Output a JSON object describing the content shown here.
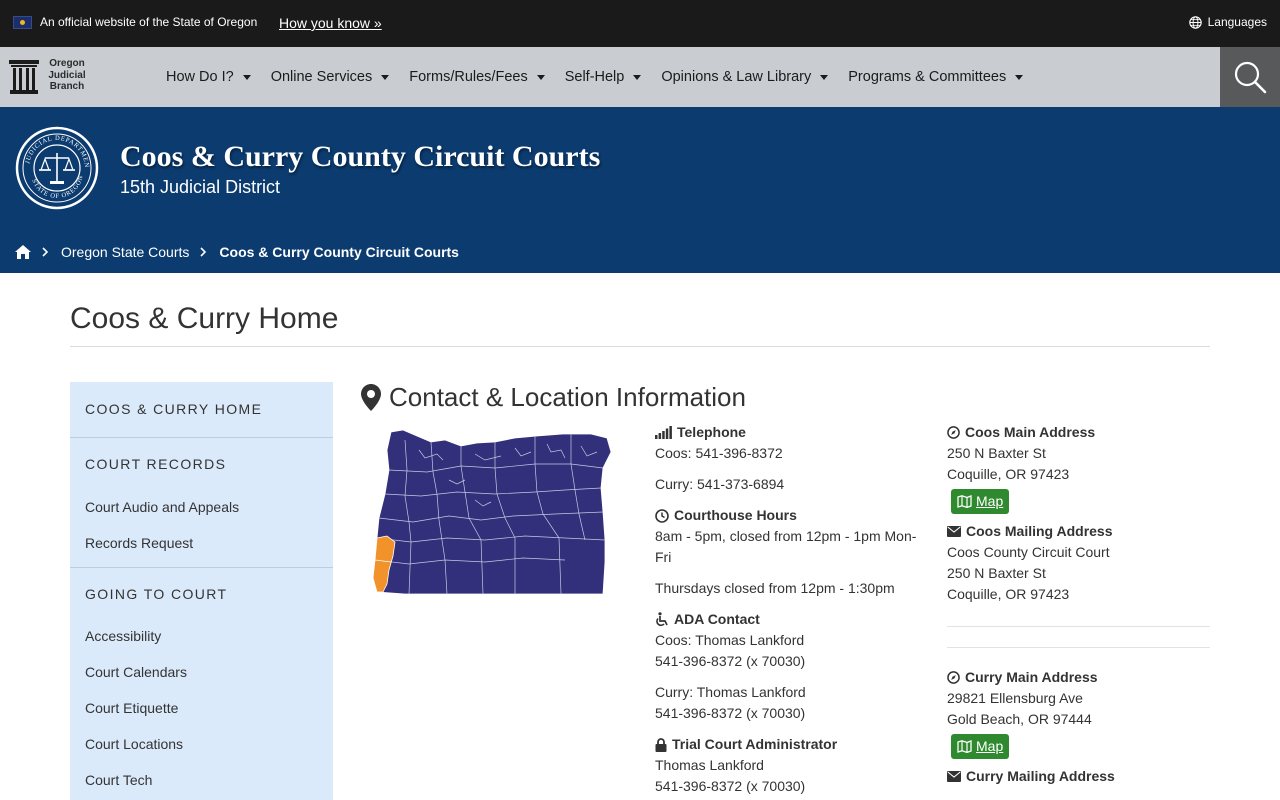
{
  "top_bar": {
    "official_text": "An official website of the State of Oregon",
    "how_you_know": "How you know »",
    "languages": "Languages"
  },
  "nav": {
    "logo_lines": [
      "Oregon",
      "Judicial",
      "Branch"
    ],
    "items": [
      {
        "label": "How Do I?"
      },
      {
        "label": "Online Services"
      },
      {
        "label": "Forms/Rules/Fees"
      },
      {
        "label": "Self-Help"
      },
      {
        "label": "Opinions & Law Library"
      },
      {
        "label": "Programs & Committees"
      }
    ]
  },
  "header": {
    "court_name": "Coos & Curry County Circuit Courts",
    "district": "15th Judicial District",
    "seal_text": "JUDICIAL DEPARTMENT · STATE OF OREGON",
    "breadcrumb": [
      "Oregon State Courts",
      "Coos & Curry County Circuit Courts"
    ]
  },
  "page": {
    "title": "Coos & Curry Home"
  },
  "sidebar": {
    "home": "COOS & CURRY HOME",
    "records_heading": "COURT RECORDS",
    "records_links": [
      "Court Audio and Appeals",
      "Records Request"
    ],
    "going_heading": "GOING TO COURT",
    "going_links": [
      "Accessibility",
      "Court Calendars",
      "Court Etiquette",
      "Court Locations",
      "Court Tech"
    ]
  },
  "contact": {
    "section_title": "Contact & Location Information",
    "telephone_label": "Telephone",
    "telephone_coos": "Coos: 541-396-8372",
    "telephone_curry": "Curry: 541-373-6894",
    "hours_label": "Courthouse Hours",
    "hours_line1": "8am - 5pm, closed from 12pm - 1pm Mon-",
    "hours_line2": "Fri",
    "hours_thursday": "Thursdays closed from 12pm - 1:30pm",
    "ada_label": "ADA Contact",
    "ada_coos_name": "Coos: Thomas Lankford",
    "ada_coos_phone": "541-396-8372 (x 70030)",
    "ada_curry_name": "Curry: Thomas Lankford",
    "ada_curry_phone": "541-396-8372 (x 70030)",
    "admin_label": "Trial Court Administrator",
    "admin_name": "Thomas Lankford",
    "admin_phone": "541-396-8372 (x 70030)"
  },
  "addresses": {
    "coos_main_label": "Coos Main Address",
    "coos_main_line1": "250 N Baxter St",
    "coos_main_line2": "Coquille, OR 97423",
    "map_label": "Map",
    "coos_mail_label": "Coos Mailing Address",
    "coos_mail_line1": "Coos County Circuit Court",
    "coos_mail_line2": "250 N Baxter St",
    "coos_mail_line3": "Coquille, OR 97423",
    "curry_main_label": "Curry Main Address",
    "curry_main_line1": "29821 Ellensburg Ave",
    "curry_main_line2": "Gold Beach, OR 97444",
    "curry_mail_label": "Curry Mailing Address"
  },
  "colors": {
    "top_bar": "#1a1a1a",
    "nav_bar": "#c9cdd1",
    "hero": "#0b3b6f",
    "sidebar": "#dbeafb",
    "map_fill": "#32307a",
    "map_highlight": "#f2922b",
    "map_button": "#2f8a2f"
  }
}
